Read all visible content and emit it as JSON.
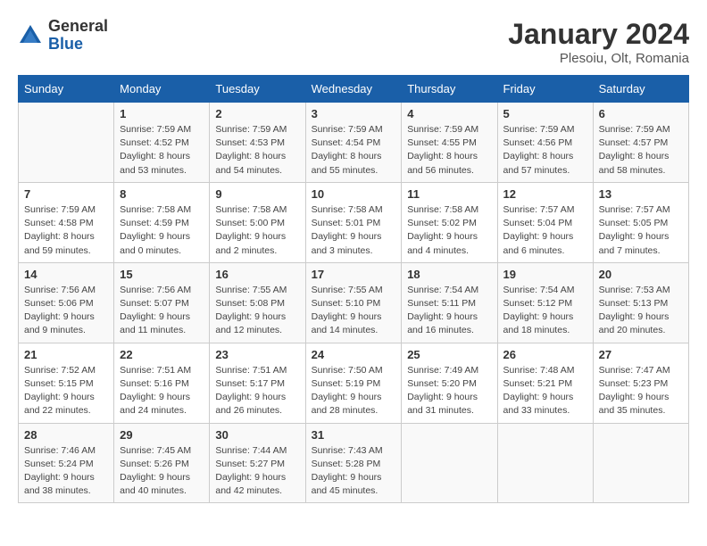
{
  "logo": {
    "general": "General",
    "blue": "Blue"
  },
  "title": {
    "month_year": "January 2024",
    "location": "Plesoiu, Olt, Romania"
  },
  "headers": [
    "Sunday",
    "Monday",
    "Tuesday",
    "Wednesday",
    "Thursday",
    "Friday",
    "Saturday"
  ],
  "weeks": [
    [
      {
        "day": "",
        "info": ""
      },
      {
        "day": "1",
        "info": "Sunrise: 7:59 AM\nSunset: 4:52 PM\nDaylight: 8 hours\nand 53 minutes."
      },
      {
        "day": "2",
        "info": "Sunrise: 7:59 AM\nSunset: 4:53 PM\nDaylight: 8 hours\nand 54 minutes."
      },
      {
        "day": "3",
        "info": "Sunrise: 7:59 AM\nSunset: 4:54 PM\nDaylight: 8 hours\nand 55 minutes."
      },
      {
        "day": "4",
        "info": "Sunrise: 7:59 AM\nSunset: 4:55 PM\nDaylight: 8 hours\nand 56 minutes."
      },
      {
        "day": "5",
        "info": "Sunrise: 7:59 AM\nSunset: 4:56 PM\nDaylight: 8 hours\nand 57 minutes."
      },
      {
        "day": "6",
        "info": "Sunrise: 7:59 AM\nSunset: 4:57 PM\nDaylight: 8 hours\nand 58 minutes."
      }
    ],
    [
      {
        "day": "7",
        "info": "Sunrise: 7:59 AM\nSunset: 4:58 PM\nDaylight: 8 hours\nand 59 minutes."
      },
      {
        "day": "8",
        "info": "Sunrise: 7:58 AM\nSunset: 4:59 PM\nDaylight: 9 hours\nand 0 minutes."
      },
      {
        "day": "9",
        "info": "Sunrise: 7:58 AM\nSunset: 5:00 PM\nDaylight: 9 hours\nand 2 minutes."
      },
      {
        "day": "10",
        "info": "Sunrise: 7:58 AM\nSunset: 5:01 PM\nDaylight: 9 hours\nand 3 minutes."
      },
      {
        "day": "11",
        "info": "Sunrise: 7:58 AM\nSunset: 5:02 PM\nDaylight: 9 hours\nand 4 minutes."
      },
      {
        "day": "12",
        "info": "Sunrise: 7:57 AM\nSunset: 5:04 PM\nDaylight: 9 hours\nand 6 minutes."
      },
      {
        "day": "13",
        "info": "Sunrise: 7:57 AM\nSunset: 5:05 PM\nDaylight: 9 hours\nand 7 minutes."
      }
    ],
    [
      {
        "day": "14",
        "info": "Sunrise: 7:56 AM\nSunset: 5:06 PM\nDaylight: 9 hours\nand 9 minutes."
      },
      {
        "day": "15",
        "info": "Sunrise: 7:56 AM\nSunset: 5:07 PM\nDaylight: 9 hours\nand 11 minutes."
      },
      {
        "day": "16",
        "info": "Sunrise: 7:55 AM\nSunset: 5:08 PM\nDaylight: 9 hours\nand 12 minutes."
      },
      {
        "day": "17",
        "info": "Sunrise: 7:55 AM\nSunset: 5:10 PM\nDaylight: 9 hours\nand 14 minutes."
      },
      {
        "day": "18",
        "info": "Sunrise: 7:54 AM\nSunset: 5:11 PM\nDaylight: 9 hours\nand 16 minutes."
      },
      {
        "day": "19",
        "info": "Sunrise: 7:54 AM\nSunset: 5:12 PM\nDaylight: 9 hours\nand 18 minutes."
      },
      {
        "day": "20",
        "info": "Sunrise: 7:53 AM\nSunset: 5:13 PM\nDaylight: 9 hours\nand 20 minutes."
      }
    ],
    [
      {
        "day": "21",
        "info": "Sunrise: 7:52 AM\nSunset: 5:15 PM\nDaylight: 9 hours\nand 22 minutes."
      },
      {
        "day": "22",
        "info": "Sunrise: 7:51 AM\nSunset: 5:16 PM\nDaylight: 9 hours\nand 24 minutes."
      },
      {
        "day": "23",
        "info": "Sunrise: 7:51 AM\nSunset: 5:17 PM\nDaylight: 9 hours\nand 26 minutes."
      },
      {
        "day": "24",
        "info": "Sunrise: 7:50 AM\nSunset: 5:19 PM\nDaylight: 9 hours\nand 28 minutes."
      },
      {
        "day": "25",
        "info": "Sunrise: 7:49 AM\nSunset: 5:20 PM\nDaylight: 9 hours\nand 31 minutes."
      },
      {
        "day": "26",
        "info": "Sunrise: 7:48 AM\nSunset: 5:21 PM\nDaylight: 9 hours\nand 33 minutes."
      },
      {
        "day": "27",
        "info": "Sunrise: 7:47 AM\nSunset: 5:23 PM\nDaylight: 9 hours\nand 35 minutes."
      }
    ],
    [
      {
        "day": "28",
        "info": "Sunrise: 7:46 AM\nSunset: 5:24 PM\nDaylight: 9 hours\nand 38 minutes."
      },
      {
        "day": "29",
        "info": "Sunrise: 7:45 AM\nSunset: 5:26 PM\nDaylight: 9 hours\nand 40 minutes."
      },
      {
        "day": "30",
        "info": "Sunrise: 7:44 AM\nSunset: 5:27 PM\nDaylight: 9 hours\nand 42 minutes."
      },
      {
        "day": "31",
        "info": "Sunrise: 7:43 AM\nSunset: 5:28 PM\nDaylight: 9 hours\nand 45 minutes."
      },
      {
        "day": "",
        "info": ""
      },
      {
        "day": "",
        "info": ""
      },
      {
        "day": "",
        "info": ""
      }
    ]
  ]
}
